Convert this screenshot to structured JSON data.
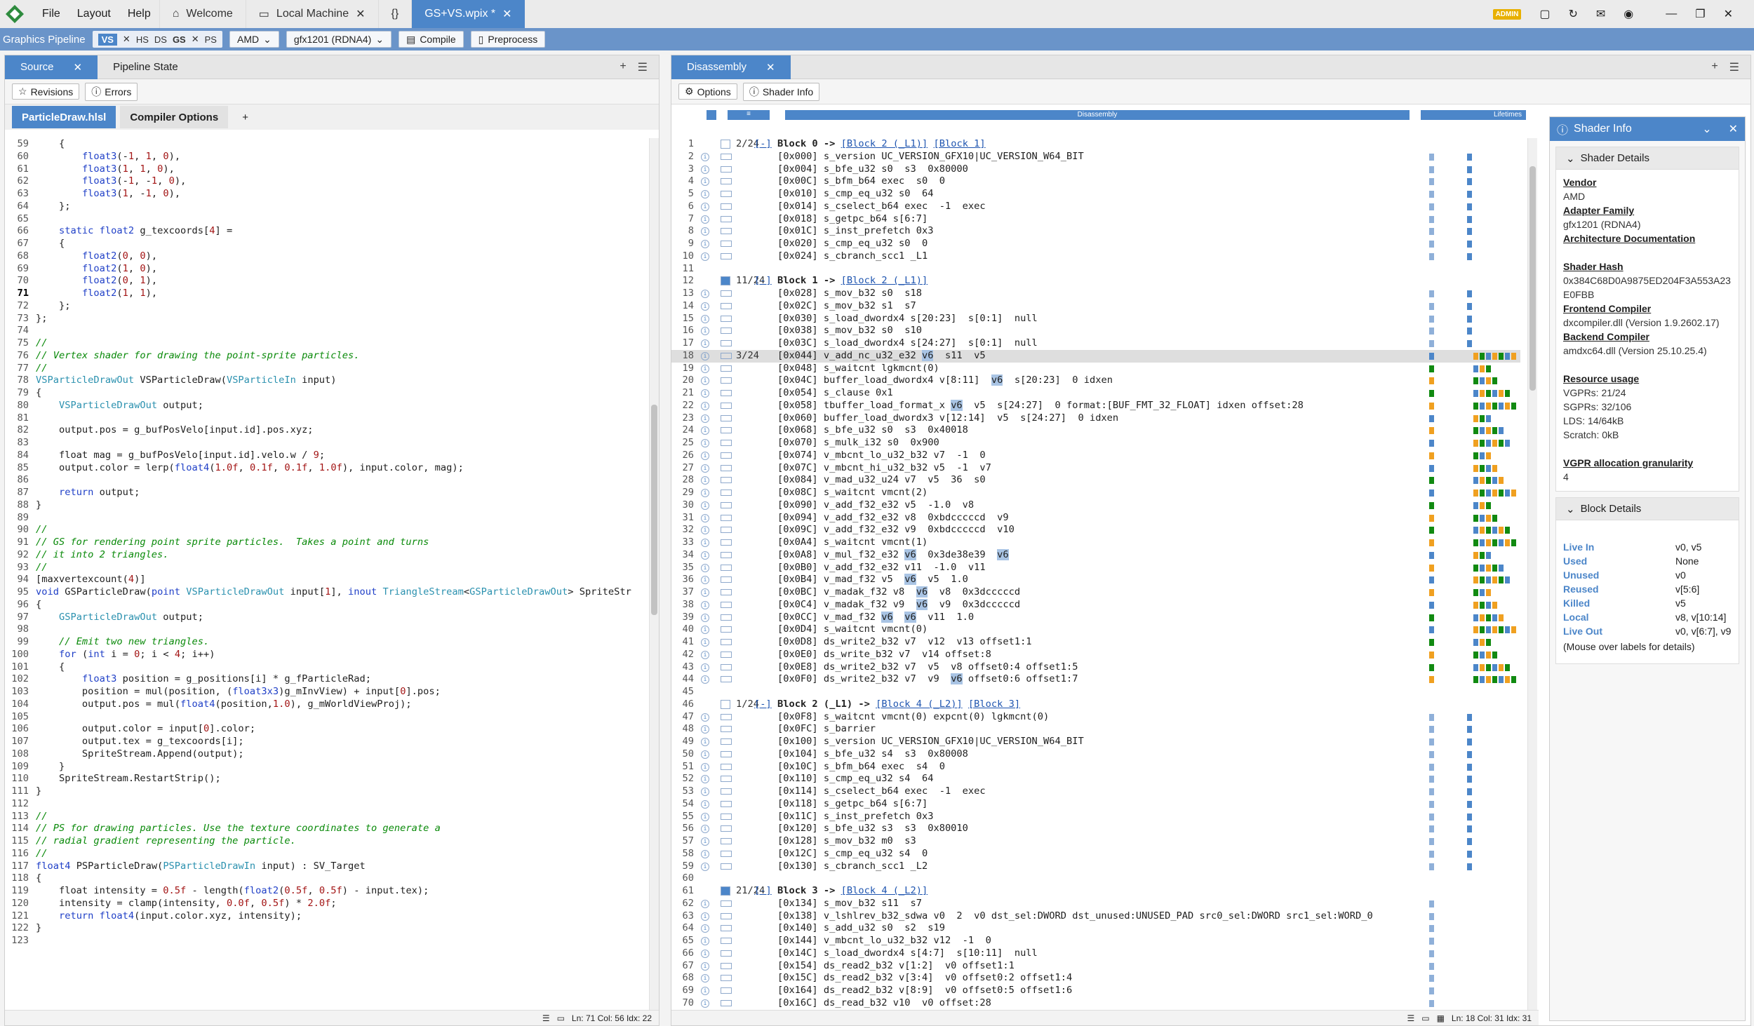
{
  "titlebar": {
    "menus": [
      "File",
      "Layout",
      "Help"
    ],
    "tabs": [
      {
        "label": "Welcome",
        "icon": "home-icon"
      },
      {
        "label": "Local Machine",
        "icon": "computer-icon"
      },
      {
        "label": "{}",
        "icon": "braces-icon"
      },
      {
        "label": "GS+VS.wpix *",
        "icon": ""
      }
    ],
    "admin": "ADMIN"
  },
  "pipeline": {
    "label": "Graphics Pipeline",
    "stages": [
      "VS",
      "HS",
      "DS",
      "GS",
      "PS"
    ],
    "vendor": "AMD",
    "target": "gfx1201 (RDNA4)",
    "compile": "Compile",
    "preprocess": "Preprocess"
  },
  "left": {
    "tabs": [
      "Source",
      "Pipeline State"
    ],
    "revisions": "Revisions",
    "errors": "Errors",
    "files": [
      "ParticleDraw.hlsl",
      "Compiler Options",
      "+"
    ],
    "status": "Ln: 71  Col: 56  Idx: 22"
  },
  "source": [
    [
      59,
      "    {"
    ],
    [
      60,
      "        float3(-1, 1, 0),"
    ],
    [
      61,
      "        float3(1, 1, 0),"
    ],
    [
      62,
      "        float3(-1, -1, 0),"
    ],
    [
      63,
      "        float3(1, -1, 0),"
    ],
    [
      64,
      "    };"
    ],
    [
      65,
      ""
    ],
    [
      66,
      "    static float2 g_texcoords[4] ="
    ],
    [
      67,
      "    {"
    ],
    [
      68,
      "        float2(0, 0),"
    ],
    [
      69,
      "        float2(1, 0),"
    ],
    [
      70,
      "        float2(0, 1),"
    ],
    [
      71,
      "        float2(1, 1),"
    ],
    [
      72,
      "    };"
    ],
    [
      73,
      "};"
    ],
    [
      74,
      ""
    ],
    [
      75,
      "//"
    ],
    [
      76,
      "// Vertex shader for drawing the point-sprite particles."
    ],
    [
      77,
      "//"
    ],
    [
      78,
      "VSParticleDrawOut VSParticleDraw(VSParticleIn input)"
    ],
    [
      79,
      "{"
    ],
    [
      80,
      "    VSParticleDrawOut output;"
    ],
    [
      81,
      ""
    ],
    [
      82,
      "    output.pos = g_bufPosVelo[input.id].pos.xyz;"
    ],
    [
      83,
      ""
    ],
    [
      84,
      "    float mag = g_bufPosVelo[input.id].velo.w / 9;"
    ],
    [
      85,
      "    output.color = lerp(float4(1.0f, 0.1f, 0.1f, 1.0f), input.color, mag);"
    ],
    [
      86,
      ""
    ],
    [
      87,
      "    return output;"
    ],
    [
      88,
      "}"
    ],
    [
      89,
      ""
    ],
    [
      90,
      "//"
    ],
    [
      91,
      "// GS for rendering point sprite particles.  Takes a point and turns"
    ],
    [
      92,
      "// it into 2 triangles."
    ],
    [
      93,
      "//"
    ],
    [
      94,
      "[maxvertexcount(4)]"
    ],
    [
      95,
      "void GSParticleDraw(point VSParticleDrawOut input[1], inout TriangleStream<GSParticleDrawOut> SpriteStr"
    ],
    [
      96,
      "{"
    ],
    [
      97,
      "    GSParticleDrawOut output;"
    ],
    [
      98,
      ""
    ],
    [
      99,
      "    // Emit two new triangles."
    ],
    [
      100,
      "    for (int i = 0; i < 4; i++)"
    ],
    [
      101,
      "    {"
    ],
    [
      102,
      "        float3 position = g_positions[i] * g_fParticleRad;"
    ],
    [
      103,
      "        position = mul(position, (float3x3)g_mInvView) + input[0].pos;"
    ],
    [
      104,
      "        output.pos = mul(float4(position,1.0), g_mWorldViewProj);"
    ],
    [
      105,
      ""
    ],
    [
      106,
      "        output.color = input[0].color;"
    ],
    [
      107,
      "        output.tex = g_texcoords[i];"
    ],
    [
      108,
      "        SpriteStream.Append(output);"
    ],
    [
      109,
      "    }"
    ],
    [
      110,
      "    SpriteStream.RestartStrip();"
    ],
    [
      111,
      "}"
    ],
    [
      112,
      ""
    ],
    [
      113,
      "//"
    ],
    [
      114,
      "// PS for drawing particles. Use the texture coordinates to generate a"
    ],
    [
      115,
      "// radial gradient representing the particle."
    ],
    [
      116,
      "//"
    ],
    [
      117,
      "float4 PSParticleDraw(PSParticleDrawIn input) : SV_Target"
    ],
    [
      118,
      "{"
    ],
    [
      119,
      "    float intensity = 0.5f - length(float2(0.5f, 0.5f) - input.tex);"
    ],
    [
      120,
      "    intensity = clamp(intensity, 0.0f, 0.5f) * 2.0f;"
    ],
    [
      121,
      "    return float4(input.color.xyz, intensity);"
    ],
    [
      122,
      "}"
    ],
    [
      123,
      ""
    ]
  ],
  "mid": {
    "tab": "Disassembly",
    "options": "Options",
    "shaderinfo": "Shader Info",
    "col_dis": "Disassembly",
    "col_life": "Lifetimes",
    "status": "Ln: 18  Col: 31  Idx: 31"
  },
  "disasm": [
    {
      "n": 1,
      "t": "h",
      "c": "2/24",
      "tx": "[-] Block 0 -> ",
      "l": [
        "[Block 2 (_L1)]",
        "[Block 1]"
      ]
    },
    {
      "n": 2,
      "tx": "    [0x000] s_version UC_VERSION_GFX10|UC_VERSION_W64_BIT"
    },
    {
      "n": 3,
      "tx": "    [0x004] s_bfe_u32 s0  s3  0x80000"
    },
    {
      "n": 4,
      "tx": "    [0x00C] s_bfm_b64 exec  s0  0"
    },
    {
      "n": 5,
      "tx": "    [0x010] s_cmp_eq_u32 s0  64"
    },
    {
      "n": 6,
      "tx": "    [0x014] s_cselect_b64 exec  -1  exec"
    },
    {
      "n": 7,
      "tx": "    [0x018] s_getpc_b64 s[6:7]"
    },
    {
      "n": 8,
      "tx": "    [0x01C] s_inst_prefetch 0x3"
    },
    {
      "n": 9,
      "tx": "    [0x020] s_cmp_eq_u32 s0  0"
    },
    {
      "n": 10,
      "tx": "    [0x024] s_cbranch_scc1 _L1"
    },
    {
      "n": 11,
      "tx": ""
    },
    {
      "n": 12,
      "t": "h",
      "c": "11/24",
      "tx": "[-] Block 1 -> ",
      "l": [
        "[Block 2 (_L1)]"
      ]
    },
    {
      "n": 13,
      "tx": "    [0x028] s_mov_b32 s0  s18"
    },
    {
      "n": 14,
      "tx": "    [0x02C] s_mov_b32 s1  s7"
    },
    {
      "n": 15,
      "tx": "    [0x030] s_load_dwordx4 s[20:23]  s[0:1]  null"
    },
    {
      "n": 16,
      "tx": "    [0x038] s_mov_b32 s0  s10"
    },
    {
      "n": 17,
      "tx": "    [0x03C] s_load_dwordx4 s[24:27]  s[0:1]  null"
    },
    {
      "n": 18,
      "c": "3/24",
      "sel": true,
      "tx": "    [0x044] v_add_nc_u32_e32 v6  s11  v5"
    },
    {
      "n": 19,
      "tx": "    [0x048] s_waitcnt lgkmcnt(0)"
    },
    {
      "n": 20,
      "tx": "    [0x04C] buffer_load_dwordx4 v[8:11]  v6  s[20:23]  0 idxen"
    },
    {
      "n": 21,
      "tx": "    [0x054] s_clause 0x1"
    },
    {
      "n": 22,
      "tx": "    [0x058] tbuffer_load_format_x v6  v5  s[24:27]  0 format:[BUF_FMT_32_FLOAT] idxen offset:28"
    },
    {
      "n": 23,
      "tx": "    [0x060] buffer_load_dwordx3 v[12:14]  v5  s[24:27]  0 idxen"
    },
    {
      "n": 24,
      "tx": "    [0x068] s_bfe_u32 s0  s3  0x40018"
    },
    {
      "n": 25,
      "tx": "    [0x070] s_mulk_i32 s0  0x900"
    },
    {
      "n": 26,
      "tx": "    [0x074] v_mbcnt_lo_u32_b32 v7  -1  0"
    },
    {
      "n": 27,
      "tx": "    [0x07C] v_mbcnt_hi_u32_b32 v5  -1  v7"
    },
    {
      "n": 28,
      "tx": "    [0x084] v_mad_u32_u24 v7  v5  36  s0"
    },
    {
      "n": 29,
      "tx": "    [0x08C] s_waitcnt vmcnt(2)"
    },
    {
      "n": 30,
      "tx": "    [0x090] v_add_f32_e32 v5  -1.0  v8"
    },
    {
      "n": 31,
      "tx": "    [0x094] v_add_f32_e32 v8  0xbdcccccd  v9"
    },
    {
      "n": 32,
      "tx": "    [0x09C] v_add_f32_e32 v9  0xbdcccccd  v10"
    },
    {
      "n": 33,
      "tx": "    [0x0A4] s_waitcnt vmcnt(1)"
    },
    {
      "n": 34,
      "tx": "    [0x0A8] v_mul_f32_e32 v6  0x3de38e39  v6"
    },
    {
      "n": 35,
      "tx": "    [0x0B0] v_add_f32_e32 v11  -1.0  v11"
    },
    {
      "n": 36,
      "tx": "    [0x0B4] v_mad_f32 v5  v6  v5  1.0"
    },
    {
      "n": 37,
      "tx": "    [0x0BC] v_madak_f32 v8  v6  v8  0x3dcccccd"
    },
    {
      "n": 38,
      "tx": "    [0x0C4] v_madak_f32 v9  v6  v9  0x3dcccccd"
    },
    {
      "n": 39,
      "tx": "    [0x0CC] v_mad_f32 v6  v6  v11  1.0"
    },
    {
      "n": 40,
      "tx": "    [0x0D4] s_waitcnt vmcnt(0)"
    },
    {
      "n": 41,
      "tx": "    [0x0D8] ds_write2_b32 v7  v12  v13 offset1:1"
    },
    {
      "n": 42,
      "tx": "    [0x0E0] ds_write_b32 v7  v14 offset:8"
    },
    {
      "n": 43,
      "tx": "    [0x0E8] ds_write2_b32 v7  v5  v8 offset0:4 offset1:5"
    },
    {
      "n": 44,
      "tx": "    [0x0F0] ds_write2_b32 v7  v9  v6 offset0:6 offset1:7"
    },
    {
      "n": 45,
      "tx": ""
    },
    {
      "n": 46,
      "t": "h",
      "c": "1/24",
      "tx": "[-] Block 2 (_L1) -> ",
      "l": [
        "[Block 4 (_L2)]",
        "[Block 3]"
      ]
    },
    {
      "n": 47,
      "tx": "    [0x0F8] s_waitcnt vmcnt(0) expcnt(0) lgkmcnt(0)"
    },
    {
      "n": 48,
      "tx": "    [0x0FC] s_barrier"
    },
    {
      "n": 49,
      "tx": "    [0x100] s_version UC_VERSION_GFX10|UC_VERSION_W64_BIT"
    },
    {
      "n": 50,
      "tx": "    [0x104] s_bfe_u32 s4  s3  0x80008"
    },
    {
      "n": 51,
      "tx": "    [0x10C] s_bfm_b64 exec  s4  0"
    },
    {
      "n": 52,
      "tx": "    [0x110] s_cmp_eq_u32 s4  64"
    },
    {
      "n": 53,
      "tx": "    [0x114] s_cselect_b64 exec  -1  exec"
    },
    {
      "n": 54,
      "tx": "    [0x118] s_getpc_b64 s[6:7]"
    },
    {
      "n": 55,
      "tx": "    [0x11C] s_inst_prefetch 0x3"
    },
    {
      "n": 56,
      "tx": "    [0x120] s_bfe_u32 s3  s3  0x80010"
    },
    {
      "n": 57,
      "tx": "    [0x128] s_mov_b32 m0  s3"
    },
    {
      "n": 58,
      "tx": "    [0x12C] s_cmp_eq_u32 s4  0"
    },
    {
      "n": 59,
      "tx": "    [0x130] s_cbranch_scc1 _L2"
    },
    {
      "n": 60,
      "tx": ""
    },
    {
      "n": 61,
      "t": "h",
      "c": "21/24",
      "tx": "[-] ",
      "l": [
        "[Block 4 (_L2)]"
      ],
      "pre": "Block 3 -> "
    },
    {
      "n": 62,
      "tx": "    [0x134] s_mov_b32 s11  s7"
    },
    {
      "n": 63,
      "tx": "    [0x138] v_lshlrev_b32_sdwa v0  2  v0 dst_sel:DWORD dst_unused:UNUSED_PAD src0_sel:DWORD src1_sel:WORD_0"
    },
    {
      "n": 64,
      "tx": "    [0x140] s_add_u32 s0  s2  s19"
    },
    {
      "n": 65,
      "tx": "    [0x144] v_mbcnt_lo_u32_b32 v12  -1  0"
    },
    {
      "n": 66,
      "tx": "    [0x14C] s_load_dwordx4 s[4:7]  s[10:11]  null"
    },
    {
      "n": 67,
      "tx": "    [0x154] ds_read2_b32 v[1:2]  v0 offset1:1"
    },
    {
      "n": 68,
      "tx": "    [0x15C] ds_read2_b32 v[3:4]  v0 offset0:2 offset1:4"
    },
    {
      "n": 69,
      "tx": "    [0x164] ds_read2_b32 v[8:9]  v0 offset0:5 offset1:6"
    },
    {
      "n": 70,
      "tx": "    [0x16C] ds_read_b32 v10  v0 offset:28"
    },
    {
      "n": 71,
      "tx": ""
    }
  ],
  "info": {
    "title": "Shader Info",
    "details": "Shader Details",
    "sections": [
      {
        "h": "Vendor",
        "v": [
          "AMD"
        ]
      },
      {
        "h": "Adapter Family",
        "v": [
          "gfx1201 (RDNA4)"
        ]
      },
      {
        "h": "Architecture Documentation",
        "v": []
      },
      {
        "h": "",
        "v": []
      },
      {
        "h": "Shader Hash",
        "v": [
          "0x384C68D0A9875ED204F3A553A23",
          "E0FBB"
        ]
      },
      {
        "h": "Frontend Compiler",
        "v": [
          "dxcompiler.dll (Version 1.9.2602.17)"
        ]
      },
      {
        "h": "Backend Compiler",
        "v": [
          "amdxc64.dll (Version 25.10.25.4)"
        ]
      },
      {
        "h": "",
        "v": []
      },
      {
        "h": "Resource usage",
        "v": [
          "VGPRs: 21/24",
          "SGPRs: 32/106",
          "LDS: 14/64kB",
          "Scratch: 0kB"
        ]
      },
      {
        "h": "",
        "v": []
      },
      {
        "h": "VGPR allocation granularity",
        "v": [
          "4"
        ]
      }
    ],
    "block": "Block Details",
    "blockrows": [
      [
        "Live In",
        "v0, v5"
      ],
      [
        "Used",
        "None"
      ],
      [
        "Unused",
        "v0"
      ],
      [
        "Reused",
        "v[5:6]"
      ],
      [
        "Killed",
        "v5"
      ],
      [
        "Local",
        "v8, v[10:14]"
      ],
      [
        "Live Out",
        "v0, v[6:7], v9"
      ]
    ],
    "hint": "(Mouse over labels for details)"
  },
  "colors": {
    "accent": "#4c86c9",
    "lt_blue": "#4c86c9",
    "lt_orange": "#f0a020",
    "lt_green": "#118a11"
  }
}
